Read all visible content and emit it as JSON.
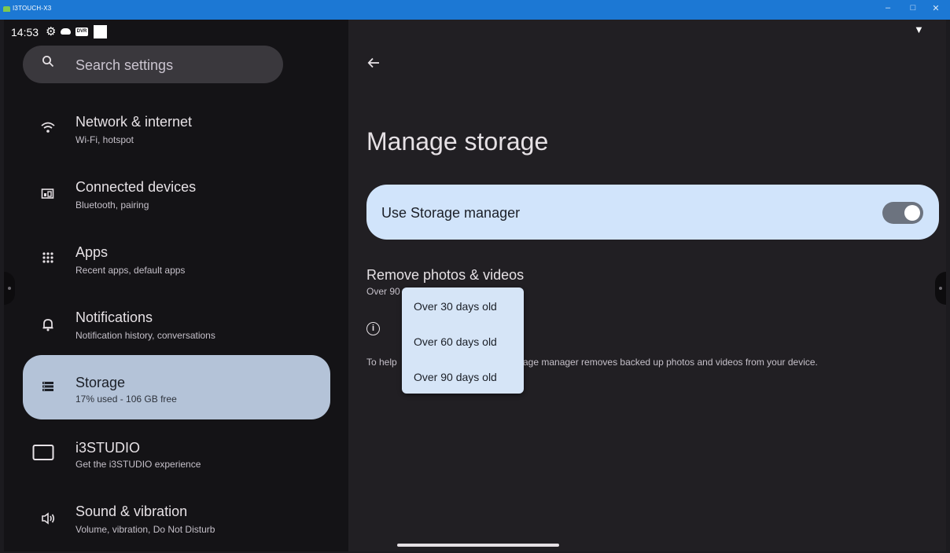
{
  "window": {
    "title": "I3TOUCH-X3",
    "controls": [
      "–",
      "□",
      "✕"
    ]
  },
  "statusbar": {
    "time": "14:53",
    "dvr_label": "DVR"
  },
  "search": {
    "placeholder": "Search settings"
  },
  "nav": {
    "items": [
      {
        "title": "Network & internet",
        "subtitle": "Wi-Fi, hotspot",
        "icon": "wifi-icon"
      },
      {
        "title": "Connected devices",
        "subtitle": "Bluetooth, pairing",
        "icon": "connected-devices-icon"
      },
      {
        "title": "Apps",
        "subtitle": "Recent apps, default apps",
        "icon": "apps-grid-icon"
      },
      {
        "title": "Notifications",
        "subtitle": "Notification history, conversations",
        "icon": "bell-icon"
      },
      {
        "title": "Storage",
        "subtitle": "17% used - 106 GB free",
        "icon": "storage-icon",
        "selected": true
      },
      {
        "title": "i3STUDIO",
        "subtitle": "Get the i3STUDIO experience",
        "icon": "monitor-icon"
      },
      {
        "title": "Sound & vibration",
        "subtitle": "Volume, vibration, Do Not Disturb",
        "icon": "speaker-icon"
      }
    ]
  },
  "main": {
    "title": "Manage storage",
    "storage_manager": {
      "label": "Use Storage manager",
      "enabled": true
    },
    "remove": {
      "title": "Remove photos & videos",
      "subtitle": "Over 90"
    },
    "info_text_left": "To help",
    "info_text_right": "age manager removes backed up photos and videos from your device."
  },
  "dropdown": {
    "options": [
      "Over 30 days old",
      "Over 60 days old",
      "Over 90 days old"
    ]
  },
  "colors": {
    "titlebar": "#1c78d4",
    "selected_nav": "#b4c3d8",
    "card": "#d1e4fb",
    "background": "#211f23"
  }
}
